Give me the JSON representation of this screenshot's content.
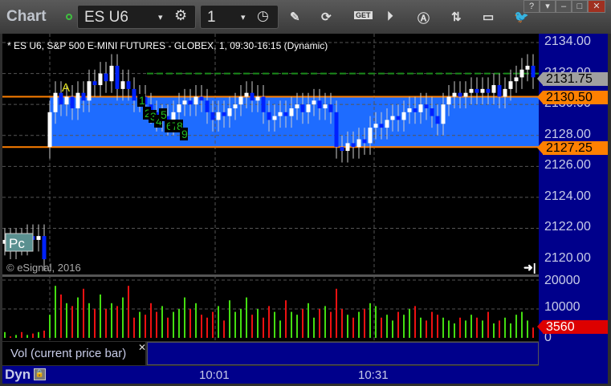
{
  "header": {
    "title": "Chart",
    "symbol": "ES U6",
    "interval": "1",
    "toolbar_icons": [
      "gear-icon",
      "clock-icon",
      "pencil-icon",
      "refresh-chart-icon",
      "get-icon",
      "play-icon",
      "alert-icon",
      "link-icon",
      "comment-icon",
      "twitter-icon"
    ],
    "get_label": "GET"
  },
  "window": {
    "help": "?",
    "dock": "▾",
    "minimize": "–",
    "maximize": "□",
    "close": "✕"
  },
  "chart": {
    "info": "* ES U6, S&P 500 E-MINI FUTURES - GLOBEX, 1, 09:30-16:15 (Dynamic)",
    "copyright": "© eSignal, 2016",
    "prior_close_label": "Pc",
    "marker_a": "A",
    "tpo_labels": [
      "1",
      "2",
      "3",
      "4",
      "5",
      "6",
      "7",
      "8",
      "9"
    ],
    "price_ticks": [
      "2134.00",
      "2132.00",
      "2130.00",
      "2128.00",
      "2126.00",
      "2124.00",
      "2122.00",
      "2120.00"
    ],
    "tags": {
      "last": "2131.75",
      "upper": "2130.50",
      "lower": "2127.25"
    },
    "colors": {
      "up": "#ffffff",
      "down": "#0022ff",
      "band": "#1e6cff",
      "level": "#ff8000",
      "last": "#a0a0a0",
      "vol_up": "#44dd11",
      "vol_down": "#ee1111",
      "volume_tag": "#dd0000"
    },
    "bars": [
      [
        2121,
        2121.25
      ],
      [
        2121.25,
        2120.75
      ],
      [
        2120.75,
        2121.25
      ],
      [
        2121.25,
        2121
      ],
      [
        2121,
        2121.5
      ],
      [
        2121.5,
        2121.25
      ],
      [
        2121.25,
        2121.5
      ],
      [
        2121.5,
        2120
      ],
      [
        2127.25,
        2129.5
      ],
      [
        2129.5,
        2130.75
      ],
      [
        2130.75,
        2130
      ],
      [
        2130,
        2130.5
      ],
      [
        2130.5,
        2129.75
      ],
      [
        2129.75,
        2130.75
      ],
      [
        2130.75,
        2130.25
      ],
      [
        2130.25,
        2131.5
      ],
      [
        2131.5,
        2131.25
      ],
      [
        2131.25,
        2132
      ],
      [
        2132,
        2131.5
      ],
      [
        2131.5,
        2132.5
      ],
      [
        2132.5,
        2131
      ],
      [
        2131,
        2131.5
      ],
      [
        2131.5,
        2131
      ],
      [
        2131,
        2130.25
      ],
      [
        2130.25,
        2130.5
      ],
      [
        2130.5,
        2130
      ],
      [
        2130,
        2129.5
      ],
      [
        2129.5,
        2129
      ],
      [
        2129,
        2129.25
      ],
      [
        2129.25,
        2128.75
      ],
      [
        2128.75,
        2129.5
      ],
      [
        2129.5,
        2130
      ],
      [
        2130,
        2130.25
      ],
      [
        2130.25,
        2130
      ],
      [
        2130,
        2130.5
      ],
      [
        2130.5,
        2130.25
      ],
      [
        2130.25,
        2129.5
      ],
      [
        2129.5,
        2129
      ],
      [
        2129,
        2129.5
      ],
      [
        2129.5,
        2129.25
      ],
      [
        2129.25,
        2129.75
      ],
      [
        2129.75,
        2130
      ],
      [
        2130,
        2130.5
      ],
      [
        2130.5,
        2130.75
      ],
      [
        2130.75,
        2130.25
      ],
      [
        2130.25,
        2130.5
      ],
      [
        2130.5,
        2129.5
      ],
      [
        2129.5,
        2129
      ],
      [
        2129,
        2129.25
      ],
      [
        2129.25,
        2129.5
      ],
      [
        2129.5,
        2129.25
      ],
      [
        2129.25,
        2129.75
      ],
      [
        2129.75,
        2130
      ],
      [
        2130,
        2129.5
      ],
      [
        2129.5,
        2130
      ],
      [
        2130,
        2130.25
      ],
      [
        2130.25,
        2129.75
      ],
      [
        2129.75,
        2130
      ],
      [
        2130,
        2129.5
      ],
      [
        2129.5,
        2127.25
      ],
      [
        2127.25,
        2127
      ],
      [
        2127,
        2127.5
      ],
      [
        2127.5,
        2127.25
      ],
      [
        2127.25,
        2127.75
      ],
      [
        2127.75,
        2127.5
      ],
      [
        2127.5,
        2128.5
      ],
      [
        2128.5,
        2128.75
      ],
      [
        2128.75,
        2128.5
      ],
      [
        2128.5,
        2129
      ],
      [
        2129,
        2129.25
      ],
      [
        2129.25,
        2129
      ],
      [
        2129,
        2129.5
      ],
      [
        2129.5,
        2129.75
      ],
      [
        2129.75,
        2129.5
      ],
      [
        2129.5,
        2130
      ],
      [
        2130,
        2129.75
      ],
      [
        2129.75,
        2129.25
      ],
      [
        2129.25,
        2128.75
      ],
      [
        2128.75,
        2130
      ],
      [
        2130,
        2130.5
      ],
      [
        2130.5,
        2130.75
      ],
      [
        2130.75,
        2130.5
      ],
      [
        2130.5,
        2130.75
      ],
      [
        2130.75,
        2131
      ],
      [
        2131,
        2130.75
      ],
      [
        2130.75,
        2131
      ],
      [
        2131,
        2130.75
      ],
      [
        2130.75,
        2131.25
      ],
      [
        2131.25,
        2130.5
      ],
      [
        2130.5,
        2131
      ],
      [
        2131,
        2131.5
      ],
      [
        2131.5,
        2131.75
      ],
      [
        2131.75,
        2132.25
      ],
      [
        2132.25,
        2132.5
      ],
      [
        2132.5,
        2131.75
      ]
    ],
    "band": [
      2127.25,
      2130.5
    ],
    "green_level": 2132.0
  },
  "volume": {
    "label": "Vol (current price bar)",
    "ticks": [
      "20000",
      "10000",
      "0"
    ],
    "last": "3560",
    "values": [
      2000,
      500,
      1000,
      2000,
      1000,
      1500,
      2000,
      2500,
      8000,
      18000,
      15000,
      12000,
      11000,
      14000,
      17000,
      12000,
      10000,
      15000,
      10000,
      12000,
      11000,
      14000,
      18000,
      7000,
      9000,
      8000,
      12000,
      9000,
      11000,
      7000,
      9000,
      10000,
      14000,
      10000,
      12000,
      8000,
      7000,
      9000,
      11000,
      6000,
      13000,
      9000,
      10000,
      14000,
      8000,
      10000,
      7000,
      11000,
      9000,
      6000,
      13000,
      9000,
      8000,
      10000,
      12000,
      7000,
      10000,
      11000,
      9000,
      17000,
      10000,
      8000,
      7000,
      9000,
      10000,
      12000,
      11000,
      7000,
      8000,
      6000,
      9000,
      8000,
      10000,
      11000,
      7000,
      6000,
      9000,
      8000,
      7000,
      6000,
      5000,
      7000,
      6000,
      8000,
      7000,
      6000,
      9000,
      5000,
      6000,
      7000,
      5000,
      8000,
      9000,
      6000,
      3560
    ]
  },
  "footer": {
    "mode": "Dyn",
    "time_labels": [
      "10:01",
      "10:31"
    ]
  }
}
